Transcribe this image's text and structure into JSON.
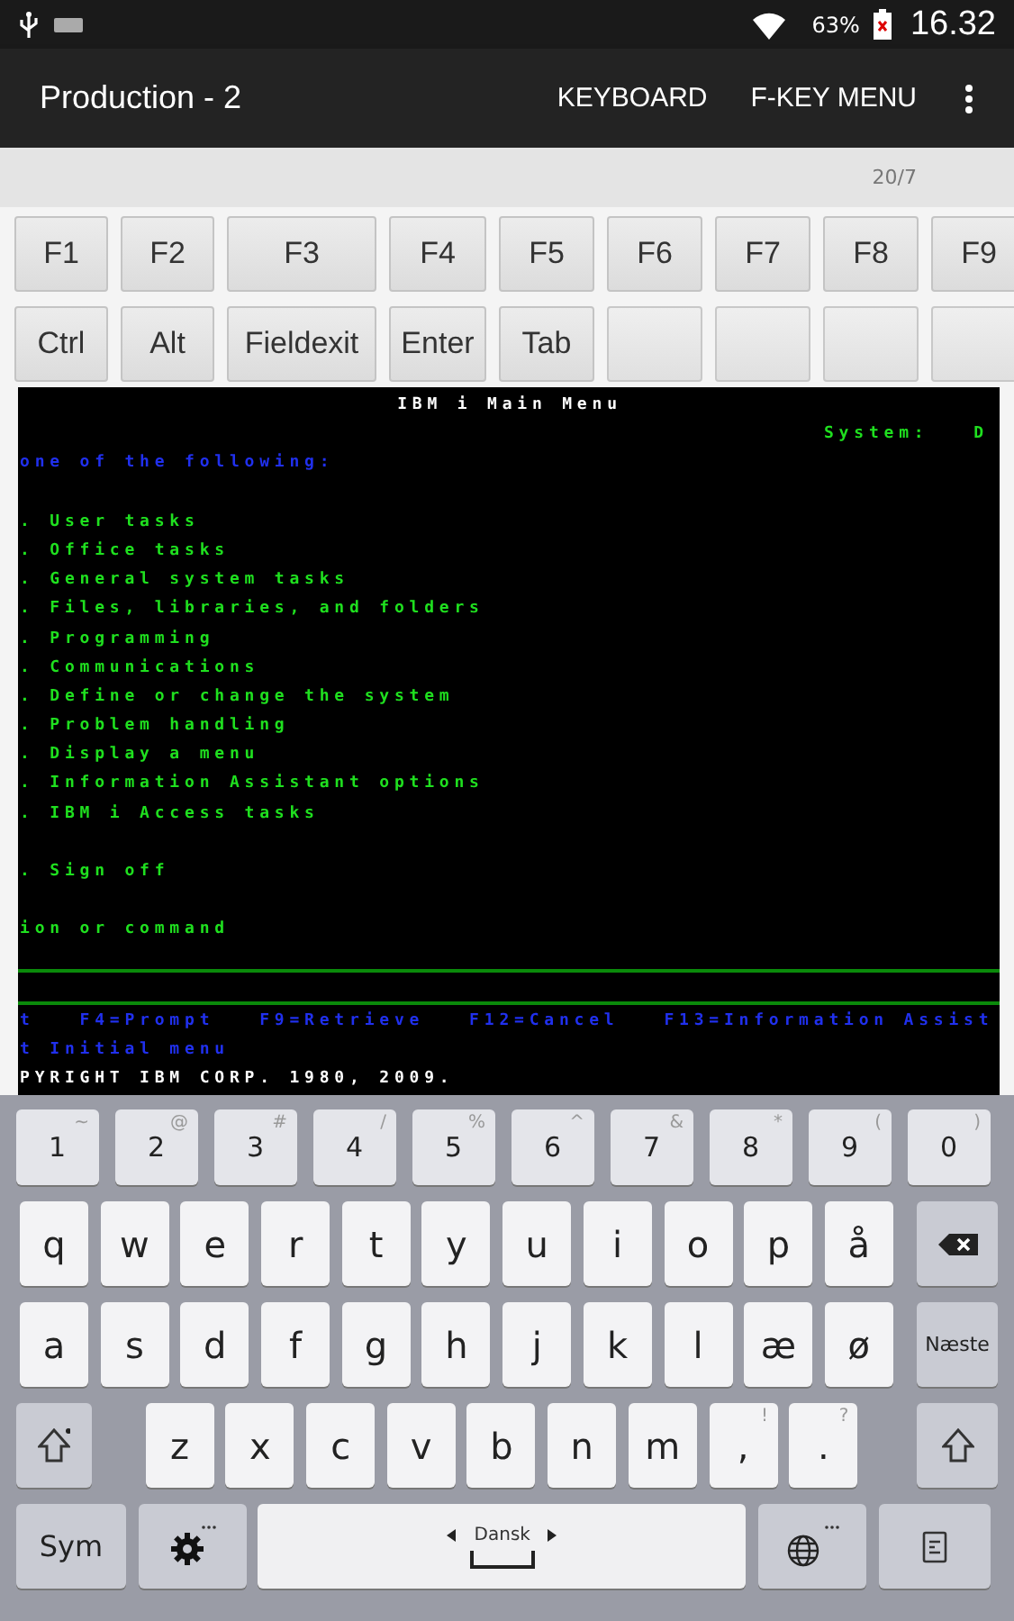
{
  "status_bar": {
    "battery": "63%",
    "time": "16.32"
  },
  "app_bar": {
    "title": "Production - 2",
    "actions": [
      "KEYBOARD",
      "F-KEY MENU"
    ]
  },
  "position": "20/7",
  "function_keys": [
    [
      {
        "kind": "key",
        "label": "F1"
      },
      {
        "kind": "key",
        "label": "F2"
      },
      {
        "kind": "key",
        "label": "F3"
      },
      {
        "kind": "key",
        "label": "F4"
      },
      {
        "kind": "key",
        "label": "F5"
      },
      {
        "kind": "key",
        "label": "F6"
      },
      {
        "kind": "key",
        "label": "F7"
      },
      {
        "kind": "key",
        "label": "F8"
      },
      {
        "kind": "key",
        "label": "F9"
      }
    ],
    [
      {
        "kind": "key",
        "label": "Ctrl"
      },
      {
        "kind": "key",
        "label": "Alt"
      },
      {
        "kind": "key",
        "label": "Fieldexit"
      },
      {
        "kind": "key",
        "label": "Enter"
      },
      {
        "kind": "key",
        "label": "Tab"
      },
      {
        "kind": "blank"
      },
      {
        "kind": "blank"
      },
      {
        "kind": "blank"
      },
      {
        "kind": "blank"
      }
    ]
  ],
  "terminal": {
    "lines": [
      {
        "kind": "title",
        "text": "IBM i Main Menu"
      },
      {
        "kind": "system",
        "text": "System:   D"
      },
      {
        "kind": "prompt",
        "text": "one of the following:"
      },
      {
        "kind": "blank"
      },
      {
        "kind": "option",
        "text": ". User tasks"
      },
      {
        "kind": "option",
        "text": ". Office tasks"
      },
      {
        "kind": "option",
        "text": ". General system tasks"
      },
      {
        "kind": "option",
        "text": ". Files, libraries, and folders"
      },
      {
        "kind": "option",
        "text": ". Programming"
      },
      {
        "kind": "option",
        "text": ". Communications"
      },
      {
        "kind": "option",
        "text": ". Define or change the system"
      },
      {
        "kind": "option",
        "text": ". Problem handling"
      },
      {
        "kind": "option",
        "text": ". Display a menu"
      },
      {
        "kind": "option",
        "text": ". Information Assistant options"
      },
      {
        "kind": "option",
        "text": ". IBM i Access tasks"
      },
      {
        "kind": "blank"
      },
      {
        "kind": "option",
        "text": ". Sign off"
      },
      {
        "kind": "blank"
      },
      {
        "kind": "option",
        "text": "ion or command"
      },
      {
        "kind": "input"
      },
      {
        "kind": "prompt",
        "text": "t   F4=Prompt   F9=Retrieve   F12=Cancel   F13=Information Assist"
      },
      {
        "kind": "prompt",
        "text": "t Initial menu"
      },
      {
        "kind": "copyright",
        "text": "PYRIGHT IBM CORP. 1980, 2009."
      }
    ]
  },
  "keyboard": {
    "language": "Dansk",
    "number_row": [
      {
        "label": "1",
        "alt": "~"
      },
      {
        "label": "2",
        "alt": "@"
      },
      {
        "label": "3",
        "alt": "#"
      },
      {
        "label": "4",
        "alt": "/"
      },
      {
        "label": "5",
        "alt": "%"
      },
      {
        "label": "6",
        "alt": "^"
      },
      {
        "label": "7",
        "alt": "&"
      },
      {
        "label": "8",
        "alt": "*"
      },
      {
        "label": "9",
        "alt": "("
      },
      {
        "label": "0",
        "alt": ")"
      }
    ],
    "rows": [
      [
        {
          "kind": "char",
          "label": "q"
        },
        {
          "kind": "char",
          "label": "w"
        },
        {
          "kind": "char",
          "label": "e"
        },
        {
          "kind": "char",
          "label": "r"
        },
        {
          "kind": "char",
          "label": "t"
        },
        {
          "kind": "char",
          "label": "y"
        },
        {
          "kind": "char",
          "label": "u"
        },
        {
          "kind": "char",
          "label": "i"
        },
        {
          "kind": "char",
          "label": "o"
        },
        {
          "kind": "char",
          "label": "p"
        },
        {
          "kind": "char",
          "label": "å"
        },
        {
          "kind": "backspace"
        }
      ],
      [
        {
          "kind": "char",
          "label": "a"
        },
        {
          "kind": "char",
          "label": "s"
        },
        {
          "kind": "char",
          "label": "d"
        },
        {
          "kind": "char",
          "label": "f"
        },
        {
          "kind": "char",
          "label": "g"
        },
        {
          "kind": "char",
          "label": "h"
        },
        {
          "kind": "char",
          "label": "j"
        },
        {
          "kind": "char",
          "label": "k"
        },
        {
          "kind": "char",
          "label": "l"
        },
        {
          "kind": "char",
          "label": "æ"
        },
        {
          "kind": "char",
          "label": "ø"
        },
        {
          "kind": "enter",
          "label": "Næste"
        }
      ],
      [
        {
          "kind": "shift",
          "dot": true
        },
        {
          "kind": "char",
          "label": "z"
        },
        {
          "kind": "char",
          "label": "x"
        },
        {
          "kind": "char",
          "label": "c"
        },
        {
          "kind": "char",
          "label": "v"
        },
        {
          "kind": "char",
          "label": "b"
        },
        {
          "kind": "char",
          "label": "n"
        },
        {
          "kind": "char",
          "label": "m"
        },
        {
          "kind": "char",
          "label": ",",
          "alt": "!"
        },
        {
          "kind": "char",
          "label": ".",
          "alt": "?"
        },
        {
          "kind": "shift",
          "dot": false
        }
      ],
      [
        {
          "kind": "sym",
          "label": "Sym"
        },
        {
          "kind": "settings"
        },
        {
          "kind": "space"
        },
        {
          "kind": "globe"
        },
        {
          "kind": "clipboard"
        }
      ]
    ]
  }
}
